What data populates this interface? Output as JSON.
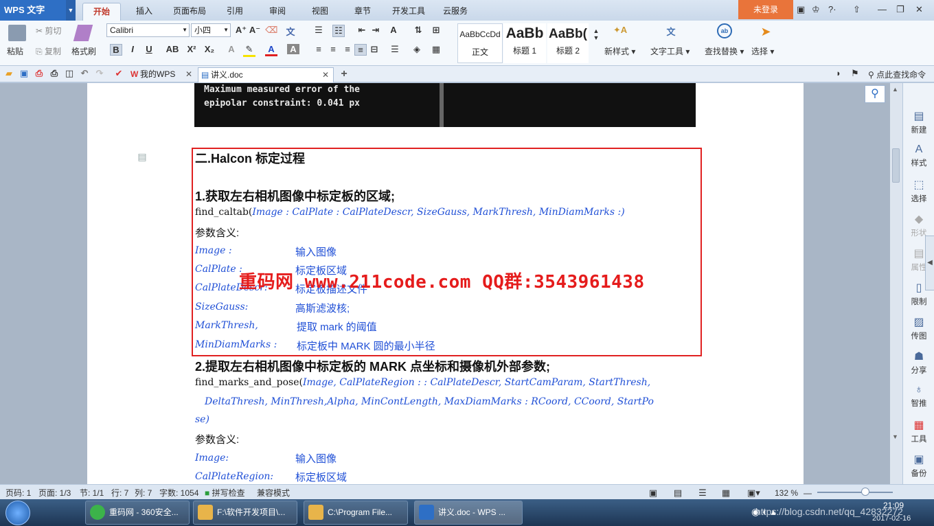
{
  "app": {
    "title": "WPS 文字",
    "login": "未登录"
  },
  "menu": {
    "tabs": [
      "开始",
      "插入",
      "页面布局",
      "引用",
      "审阅",
      "视图",
      "章节",
      "开发工具",
      "云服务"
    ]
  },
  "ribbon": {
    "paste": "粘贴",
    "cut": "剪切",
    "copy": "复制",
    "format_painter": "格式刷",
    "font": "Calibri",
    "size": "小四",
    "styles": [
      {
        "preview": "AaBbCcDd",
        "label": "正文"
      },
      {
        "preview": "AaBb",
        "label": "标题 1"
      },
      {
        "preview": "AaBb(",
        "label": "标题 2"
      }
    ],
    "new_style": "新样式",
    "text_tools": "文字工具",
    "find_replace": "查找替换",
    "select": "选择"
  },
  "quickbar": {
    "tabs": [
      {
        "label": "我的WPS"
      },
      {
        "label": "讲义.doc"
      }
    ],
    "search": "点此查找命令"
  },
  "document": {
    "image_lines": [
      "Maximum measured error of the",
      "epipolar constraint: 0.041 px"
    ],
    "section_title": "二.Halcon 标定过程",
    "step1_title": "1.获取左右相机图像中标定板的区域;",
    "step1_sig_fn": "find_caltab(",
    "step1_sig_params": "Image  :  CalPlate  :  CalPlateDescr,   SizeGauss,   MarkThresh,   MinDiamMarks  :)",
    "params_label": "参数含义:",
    "step1_params": [
      {
        "name": "Image  :",
        "desc": "输入图像"
      },
      {
        "name": "CalPlate  :",
        "desc": "标定板区域"
      },
      {
        "name": "CalPlateDescr:",
        "desc": "标定板描述文件"
      },
      {
        "name": "SizeGauss:",
        "desc": "高斯滤波核;"
      },
      {
        "name": "MarkThresh,",
        "desc": "提取 mark 的阈值"
      },
      {
        "name": "MinDiamMarks  :",
        "desc": "标定板中 MARK 圆的最小半径"
      }
    ],
    "step2_title": "2.提取左右相机图像中标定板的 MARK 点坐标和摄像机外部参数;",
    "step2_sig_fn": "find_marks_and_pose(",
    "step2_sig_line1": "Image,   CalPlateRegion  :  :  CalPlateDescr,   StartCamParam,   StartThresh,",
    "step2_sig_line2": "DeltaThresh,   MinThresh,Alpha,   MinContLength,   MaxDiamMarks  :  RCoord,   CCoord,   StartPo",
    "step2_sig_line3": "se)",
    "params_label2": "参数含义:",
    "step2_params": [
      {
        "name": "Image:",
        "desc": "输入图像"
      },
      {
        "name": "CalPlateRegion:",
        "desc": "标定板区域"
      }
    ],
    "watermark": "重码网 www.211code.com  QQ群:3543961438"
  },
  "rightbar": [
    "新建",
    "样式",
    "选择",
    "形状",
    "属性",
    "限制",
    "传图",
    "分享",
    "智推",
    "工具",
    "备份"
  ],
  "status": {
    "page_code": "页码: 1",
    "page": "页面: 1/3",
    "section": "节: 1/1",
    "row": "行: 7",
    "col": "列: 7",
    "words": "字数: 1054",
    "spell": "拼写检查",
    "compat": "兼容模式",
    "zoom": "132 %"
  },
  "taskbar": {
    "items": [
      "重码网 - 360安全...",
      "F:\\软件开发项目\\...",
      "C:\\Program File...",
      "讲义.doc - WPS ..."
    ],
    "time": "21:09",
    "date": "2017-02-16",
    "url_overlay": "https://blog.csdn.net/qq_42832272"
  }
}
